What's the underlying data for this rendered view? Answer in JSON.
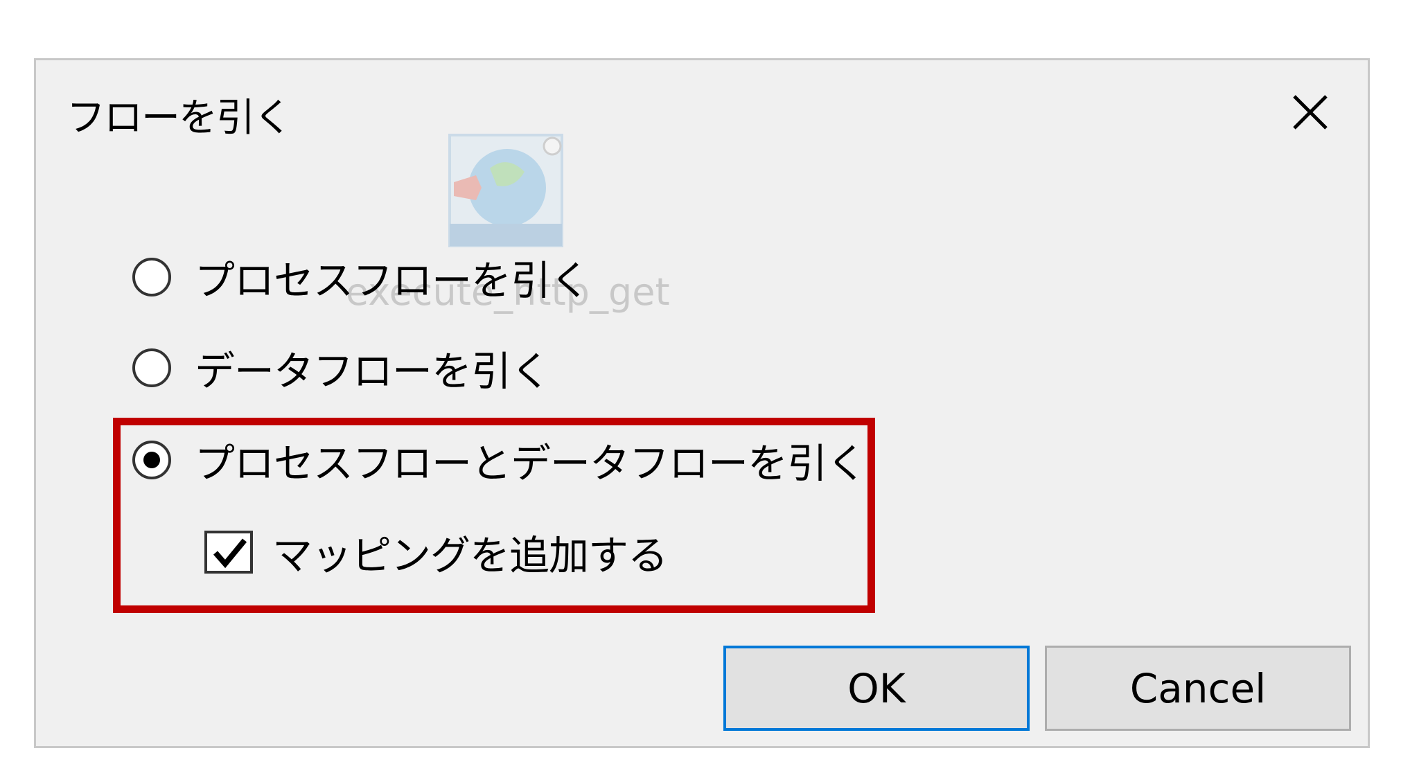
{
  "dialog": {
    "title": "フローを引く",
    "close_icon": "close-icon",
    "background_label": "execute_http_get",
    "background_icon": "rest-globe-icon",
    "options": [
      {
        "label": "プロセスフローを引く",
        "selected": false
      },
      {
        "label": "データフローを引く",
        "selected": false
      },
      {
        "label": "プロセスフローとデータフローを引く",
        "selected": true
      }
    ],
    "checkbox": {
      "label": "マッピングを追加する",
      "checked": true
    },
    "buttons": {
      "ok": "OK",
      "cancel": "Cancel"
    },
    "colors": {
      "dialog_bg": "#f0f0f0",
      "highlight": "#c00000",
      "primary_border": "#0078d7"
    }
  }
}
